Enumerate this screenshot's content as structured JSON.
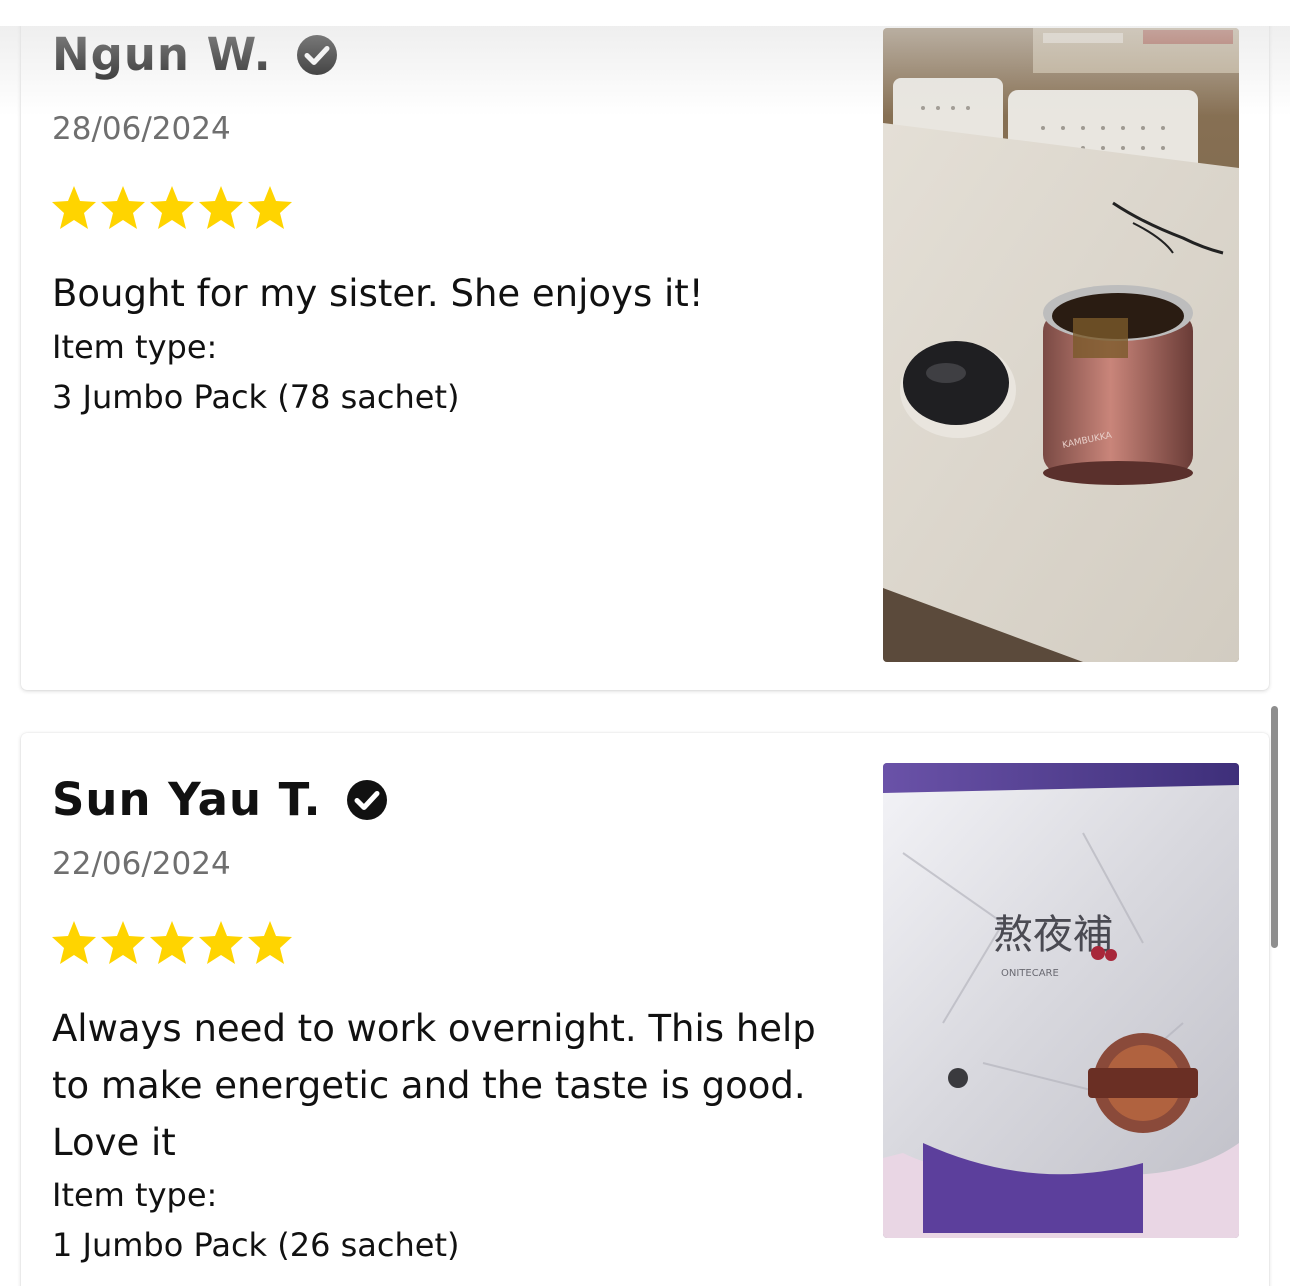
{
  "reviews": [
    {
      "name": "Ngun W.",
      "date": "28/06/2024",
      "rating": 5,
      "text": "Bought for my sister. She enjoys it!",
      "item_type_label": "Item type:",
      "item_type_value": "3 Jumbo Pack (78 sachet)",
      "photo_alt": "photo-food-jar"
    },
    {
      "name": "Sun Yau T.",
      "date": "22/06/2024",
      "rating": 5,
      "text": "Always need to work overnight. This help to make energetic and the taste is good. Love it",
      "item_type_label": "Item type:",
      "item_type_value": "1 Jumbo Pack (26 sachet)",
      "photo_alt": "photo-product-bag",
      "photo_text": {
        "chinese": "熬夜補",
        "brand": "ONITECARE"
      }
    }
  ],
  "colors": {
    "star": "#FFD400",
    "verified": "#111111",
    "date": "#6f6f6f"
  },
  "icons": {
    "verified": "verified-check-icon",
    "star": "star-icon"
  }
}
